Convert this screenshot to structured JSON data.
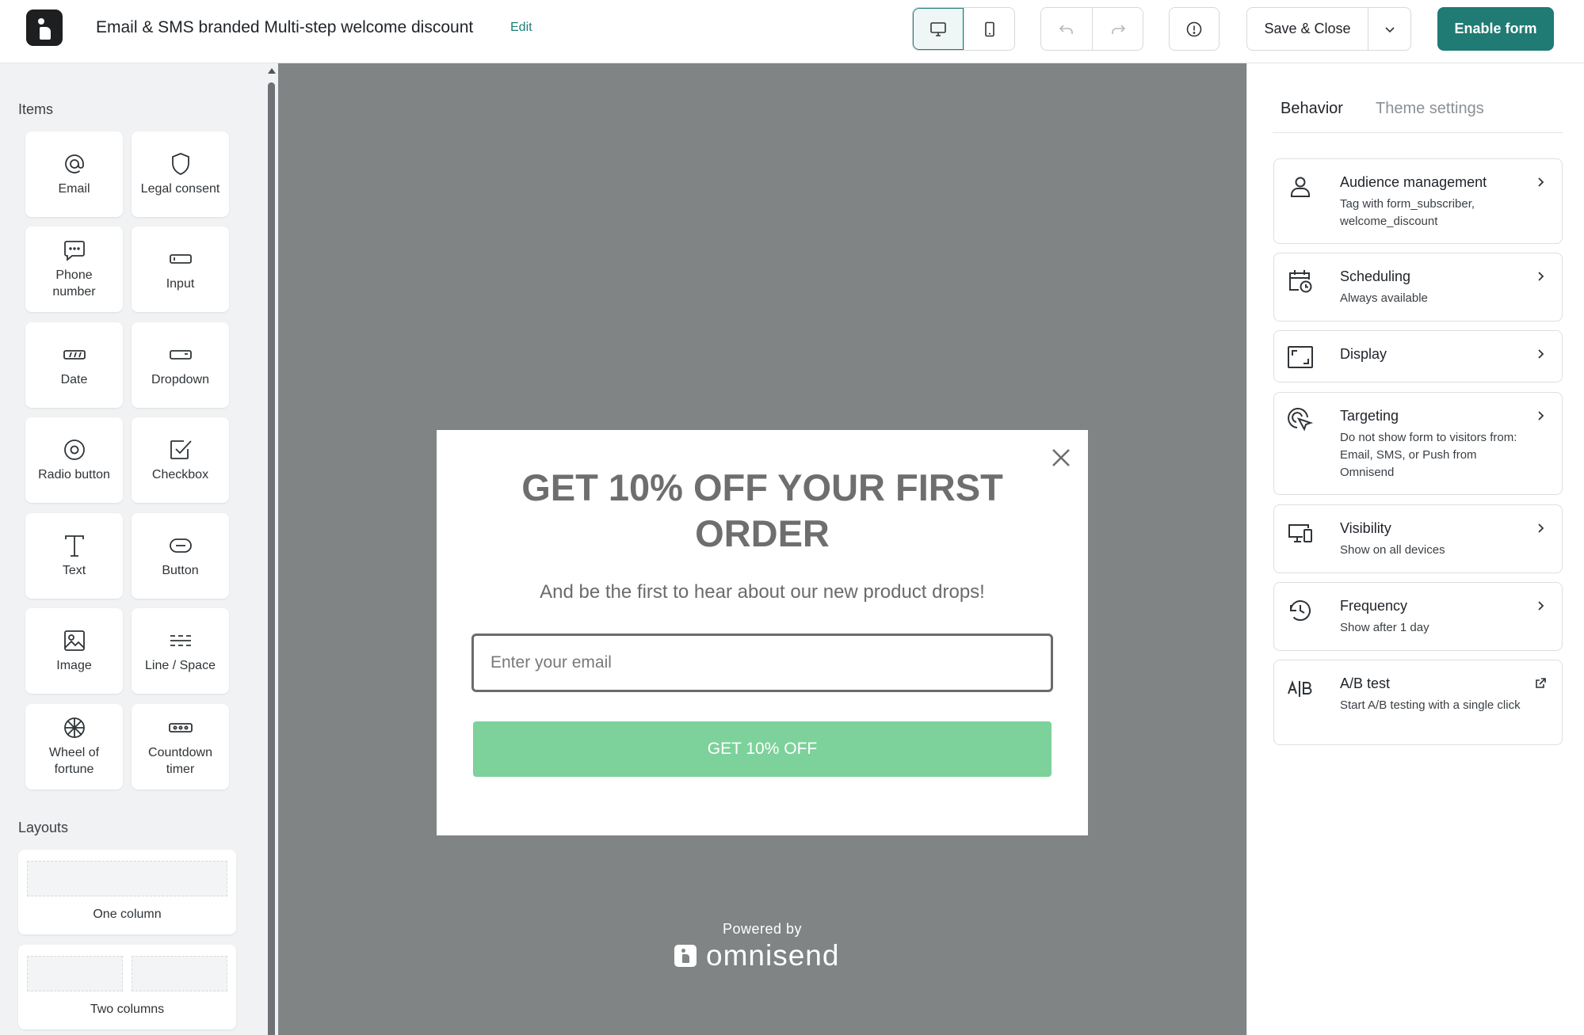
{
  "header": {
    "title": "Email & SMS branded Multi-step welcome discount",
    "edit_label": "Edit",
    "save_label": "Save & Close",
    "enable_label": "Enable form"
  },
  "sidebar": {
    "items_heading": "Items",
    "items": [
      {
        "label": "Email",
        "icon": "at-icon"
      },
      {
        "label": "Legal consent",
        "icon": "shield-icon"
      },
      {
        "label": "Phone number",
        "icon": "chat-bubble-icon"
      },
      {
        "label": "Input",
        "icon": "input-icon"
      },
      {
        "label": "Date",
        "icon": "date-icon"
      },
      {
        "label": "Dropdown",
        "icon": "dropdown-icon"
      },
      {
        "label": "Radio button",
        "icon": "radio-icon"
      },
      {
        "label": "Checkbox",
        "icon": "checkbox-icon"
      },
      {
        "label": "Text",
        "icon": "text-icon"
      },
      {
        "label": "Button",
        "icon": "button-icon"
      },
      {
        "label": "Image",
        "icon": "image-icon"
      },
      {
        "label": "Line / Space",
        "icon": "line-space-icon"
      },
      {
        "label": "Wheel of fortune",
        "icon": "wheel-icon"
      },
      {
        "label": "Countdown timer",
        "icon": "timer-icon"
      }
    ],
    "layouts_heading": "Layouts",
    "layouts": [
      {
        "label": "One column"
      },
      {
        "label": "Two columns"
      }
    ]
  },
  "popup": {
    "headline": "GET 10% OFF YOUR FIRST ORDER",
    "subline": "And be the first to hear about our new product drops!",
    "email_placeholder": "Enter your email",
    "cta_label": "GET 10% OFF",
    "cta_color": "#7dd19a",
    "powered_by": "Powered by",
    "brand": "omnisend"
  },
  "right_panel": {
    "tabs": [
      {
        "label": "Behavior",
        "active": true
      },
      {
        "label": "Theme settings",
        "active": false
      }
    ],
    "settings": [
      {
        "title": "Audience management",
        "desc": "Tag with form_subscriber, welcome_discount",
        "icon": "person-icon"
      },
      {
        "title": "Scheduling",
        "desc": "Always available",
        "icon": "calendar-clock-icon"
      },
      {
        "title": "Display",
        "desc": "",
        "icon": "display-frame-icon"
      },
      {
        "title": "Targeting",
        "desc": "Do not show form to visitors from: Email, SMS, or Push from Omnisend",
        "icon": "target-cursor-icon"
      },
      {
        "title": "Visibility",
        "desc": "Show on all devices",
        "icon": "devices-icon"
      },
      {
        "title": "Frequency",
        "desc": "Show after 1 day",
        "icon": "history-icon"
      },
      {
        "title": "A/B test",
        "desc": "Start A/B testing with a single click",
        "icon": "ab-test-icon"
      }
    ]
  },
  "colors": {
    "accent": "#1f7b73",
    "canvas_bg": "#808484"
  }
}
